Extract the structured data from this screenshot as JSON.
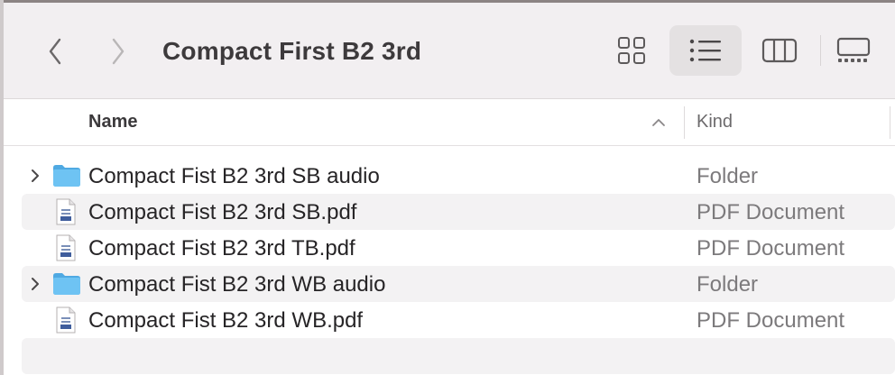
{
  "window": {
    "title": "Compact First B2 3rd"
  },
  "toolbar": {
    "back_icon": "chevron-left-icon",
    "forward_icon": "chevron-right-icon",
    "view_modes": [
      "icon-view",
      "list-view",
      "column-view",
      "gallery-view"
    ],
    "selected_view": "list-view"
  },
  "columns": {
    "name": "Name",
    "kind": "Kind",
    "sort_icon": "chevron-up-icon"
  },
  "files": [
    {
      "name": "Compact Fist B2 3rd SB audio",
      "kind": "Folder",
      "type": "folder",
      "expandable": true
    },
    {
      "name": "Compact Fist B2 3rd SB.pdf",
      "kind": "PDF Document",
      "type": "pdf",
      "expandable": false
    },
    {
      "name": "Compact Fist B2 3rd TB.pdf",
      "kind": "PDF Document",
      "type": "pdf",
      "expandable": false
    },
    {
      "name": "Compact Fist B2 3rd WB audio",
      "kind": "Folder",
      "type": "folder",
      "expandable": true
    },
    {
      "name": "Compact Fist B2 3rd WB.pdf",
      "kind": "PDF Document",
      "type": "pdf",
      "expandable": false
    }
  ],
  "colors": {
    "folder_blue": "#5db7ec",
    "window_bg": "#f2eff1",
    "row_alt": "#f3f2f3"
  }
}
